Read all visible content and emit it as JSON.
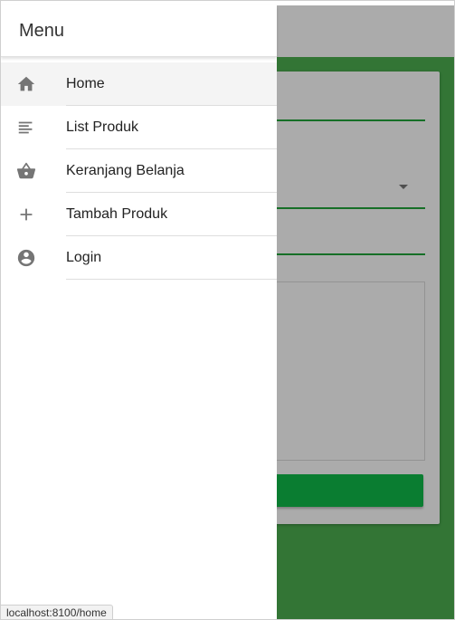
{
  "menu": {
    "title": "Menu",
    "items": [
      {
        "label": "Home",
        "icon": "home-icon",
        "active": true
      },
      {
        "label": "List Produk",
        "icon": "list-icon"
      },
      {
        "label": "Keranjang Belanja",
        "icon": "basket-icon"
      },
      {
        "label": "Tambah Produk",
        "icon": "add-icon"
      },
      {
        "label": "Login",
        "icon": "account-icon"
      }
    ]
  },
  "status_bar": {
    "url": "localhost:8100/home"
  },
  "colors": {
    "content_background": "#4caf50",
    "accent_line": "#21a63b",
    "submit_button": "#0fbb4a",
    "icon": "#757575",
    "active_item": "#f4f4f4"
  }
}
